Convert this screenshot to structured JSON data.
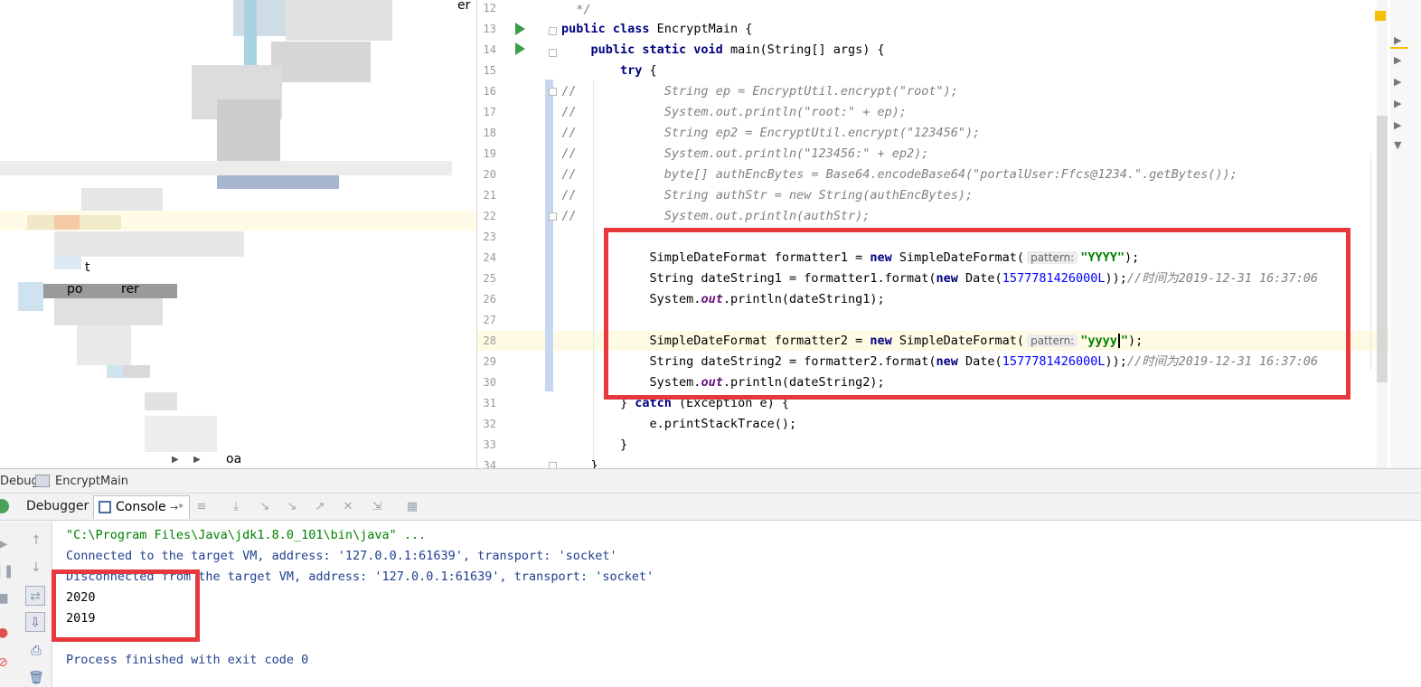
{
  "tree": {
    "fragments": [
      "er",
      "t",
      "ро",
      "rer",
      "oa"
    ]
  },
  "editor": {
    "line_numbers": [
      "12",
      "13",
      "14",
      "15",
      "16",
      "17",
      "18",
      "19",
      "20",
      "21",
      "22",
      "23",
      "24",
      "25",
      "26",
      "27",
      "28",
      "29",
      "30",
      "31",
      "32",
      "33",
      "34"
    ],
    "lines": {
      "l12": "  */",
      "l13_kw": "public class",
      "l13_rest": " EncryptMain {",
      "l14_kw": "    public static void",
      "l14_rest": " main(String[] args) {",
      "l15_kw": "        try",
      "l15_rest": " {",
      "l16": "            String ep = EncryptUtil.encrypt(\"root\");",
      "l17": "            System.out.println(\"root:\" + ep);",
      "l18": "            String ep2 = EncryptUtil.encrypt(\"123456\");",
      "l19": "            System.out.println(\"123456:\" + ep2);",
      "l20": "            byte[] authEncBytes = Base64.encodeBase64(\"portalUser:Ffcs@1234.\".getBytes());",
      "l21": "            String authStr = new String(authEncBytes);",
      "l22": "            System.out.println(authStr);",
      "comment_prefix": "//",
      "sdf_decl1": "            SimpleDateFormat formatter1 = ",
      "sdf_decl2": "            SimpleDateFormat formatter2 = ",
      "new_kw": "new",
      "sdf_ctor": " SimpleDateFormat(",
      "hint_pattern": "pattern:",
      "pattern1": "\"YYYY\"",
      "pattern2": "\"yyyy",
      "pattern2_end": "\"",
      "close_paren_semi": ");",
      "ds1_decl": "            String dateString1 = formatter1.format(",
      "ds2_decl": "            String dateString2 = formatter2.format(",
      "date_ctor": " Date(",
      "timestamp": "1577781426000L",
      "ds_close": "));",
      "ds_comment": "//时间为2019-12-31 16:37:06",
      "println_pre": "            System.",
      "out_field": "out",
      "println1_post": ".println(dateString1);",
      "println2_post": ".println(dateString2);",
      "l31_pre": "        } ",
      "l31_kw": "catch",
      "l31_post": " (Exception e) {",
      "l32": "            e.printStackTrace();",
      "l33": "        }",
      "l34": "    }"
    }
  },
  "debug": {
    "panel_label": "Debug",
    "config_name": "EncryptMain",
    "tab_debugger": "Debugger",
    "tab_console": "Console",
    "console_pin": "→*"
  },
  "console": {
    "cmd": "\"C:\\Program Files\\Java\\jdk1.8.0_101\\bin\\java\" ...",
    "connected": "Connected to the target VM, address: '127.0.0.1:61639', transport: 'socket'",
    "disconnected": "Disconnected from the target VM, address: '127.0.0.1:61639', transport: 'socket'",
    "out1": "2020",
    "out2": "2019",
    "finished": "Process finished with exit code 0"
  },
  "colors": {
    "highlight_box": "#e8383d",
    "keyword": "#000080",
    "string": "#008000",
    "number": "#0000ff",
    "comment": "#808080",
    "current_line": "#fffae3"
  }
}
